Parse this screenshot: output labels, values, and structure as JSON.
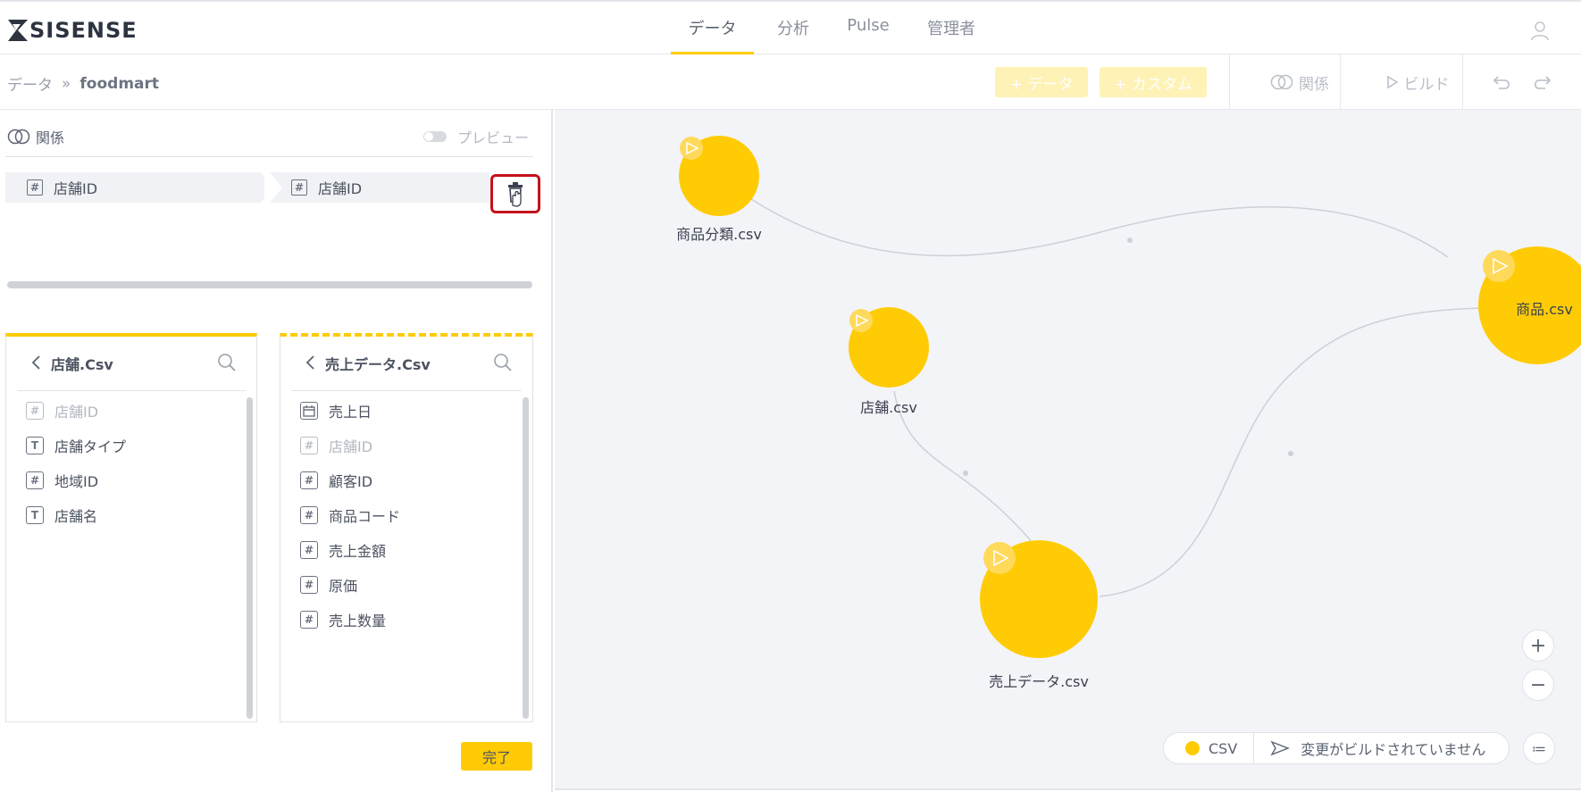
{
  "brand": {
    "name": "SISENSE"
  },
  "nav": {
    "tabs": [
      {
        "label": "データ",
        "active": true
      },
      {
        "label": "分析"
      },
      {
        "label": "Pulse"
      },
      {
        "label": "管理者"
      }
    ]
  },
  "breadcrumb": {
    "parent": "データ",
    "separator": "»",
    "current": "foodmart"
  },
  "toolbar": {
    "add_data_label": "+ データ",
    "add_custom_label": "+ カスタム",
    "relations_label": "関係",
    "build_label": "ビルド"
  },
  "relation_panel": {
    "title": "関係",
    "preview_label": "プレビュー",
    "left_field": "店舗ID",
    "right_field": "店舗ID",
    "done_label": "完了"
  },
  "left_table": {
    "title": "店舗.Csv",
    "fields": [
      {
        "label": "店舗ID",
        "icon": "#",
        "dim": true
      },
      {
        "label": "店舗タイプ",
        "icon": "T"
      },
      {
        "label": "地域ID",
        "icon": "#"
      },
      {
        "label": "店舗名",
        "icon": "T"
      }
    ]
  },
  "right_table": {
    "title": "売上データ.Csv",
    "fields": [
      {
        "label": "売上日",
        "icon": "cal"
      },
      {
        "label": "店舗ID",
        "icon": "#",
        "dim": true
      },
      {
        "label": "顧客ID",
        "icon": "#"
      },
      {
        "label": "商品コード",
        "icon": "#"
      },
      {
        "label": "売上金額",
        "icon": "#"
      },
      {
        "label": "原価",
        "icon": "#"
      },
      {
        "label": "売上数量",
        "icon": "#"
      }
    ]
  },
  "canvas": {
    "nodes": [
      {
        "label": "商品分類.csv"
      },
      {
        "label": "店舗.csv"
      },
      {
        "label": "売上データ.csv"
      },
      {
        "label": "商品.csv"
      }
    ],
    "zoom_in": "+",
    "zoom_out": "−",
    "list_icon_glyph": "≔",
    "legend": {
      "type_label": "CSV",
      "status": "変更がビルドされていません"
    }
  },
  "colors": {
    "accent": "#ffcb05",
    "highlight": "#c4121b",
    "canvas_bg": "#f3f4f8"
  }
}
